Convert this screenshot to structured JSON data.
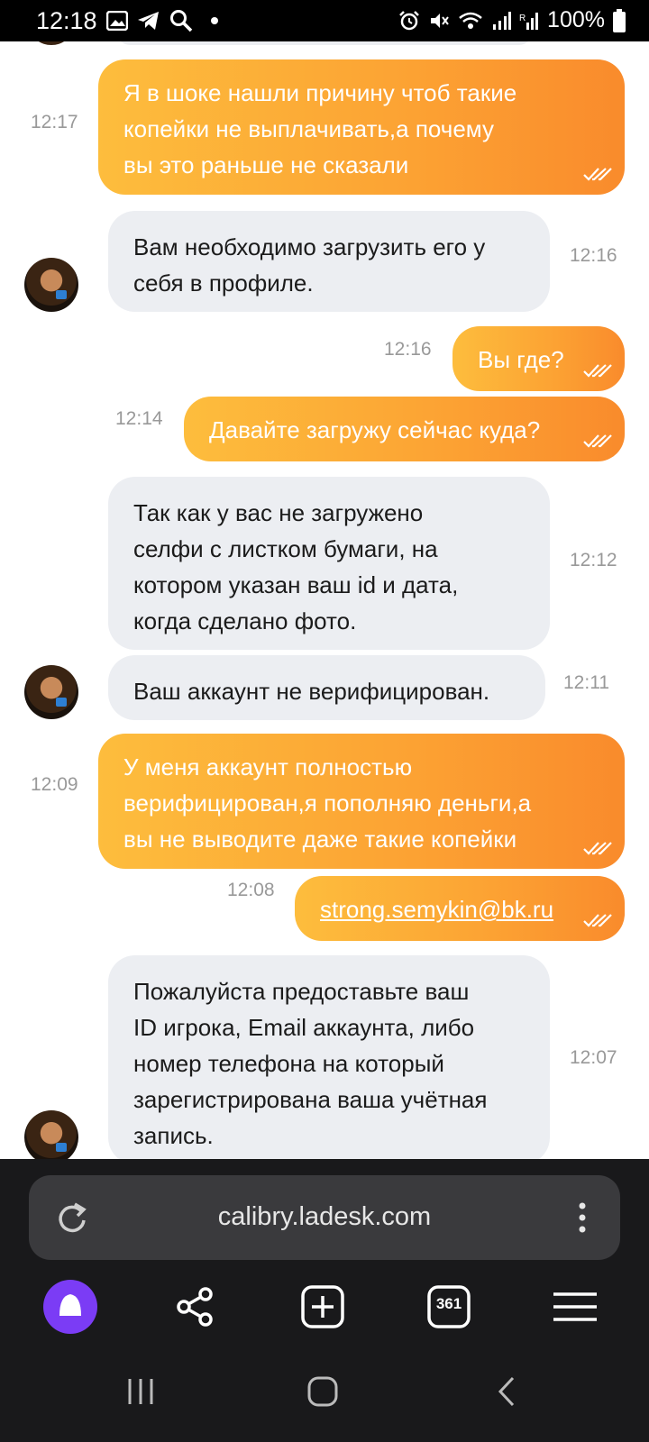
{
  "status_bar": {
    "time": "12:18",
    "battery": "100%"
  },
  "messages": [
    {
      "dir": "out",
      "time": "12:17",
      "lines": [
        "Я в шоке нашли причину чтоб такие",
        "копейки не выплачивать,а почему",
        "вы это раньше не сказали"
      ]
    },
    {
      "dir": "in",
      "time": "12:16",
      "lines": [
        "Вам необходимо загрузить его у",
        "себя в профиле."
      ]
    },
    {
      "dir": "out",
      "time": "12:16",
      "lines": [
        "Вы где?"
      ]
    },
    {
      "dir": "out",
      "time": "12:14",
      "lines": [
        "Давайте загружу сейчас куда?"
      ]
    },
    {
      "dir": "in",
      "time": "12:12",
      "lines": [
        "Так как у вас не загружено",
        "селфи с листком бумаги, на",
        "котором указан ваш id и дата,",
        "когда сделано фото."
      ]
    },
    {
      "dir": "in",
      "time": "12:11",
      "lines": [
        "Ваш аккаунт не верифицирован."
      ]
    },
    {
      "dir": "out",
      "time": "12:09",
      "lines": [
        "У меня аккаунт полностью",
        "верифицирован,я пополняю деньги,а",
        "вы не выводите даже такие копейки"
      ]
    },
    {
      "dir": "out",
      "time": "12:08",
      "lines": [
        "strong.semykin@bk.ru"
      ]
    },
    {
      "dir": "in",
      "time": "12:07",
      "lines": [
        "Пожалуйста предоставьте  ваш",
        "ID игрока, Email аккаунта, либо",
        "номер телефона на который",
        "зарегистрирована ваша учётная",
        "запись."
      ]
    }
  ],
  "browser": {
    "url": "calibry.ladesk.com",
    "tabs_count": "361"
  },
  "icons": {
    "status": [
      "gallery-icon",
      "telegram-icon",
      "search-icon",
      "dot-icon",
      "alarm-icon",
      "mute-icon",
      "wifi-icon",
      "signal-icon",
      "signal-r-icon",
      "battery-icon"
    ],
    "toolbar": [
      "alice-icon",
      "share-icon",
      "new-tab-icon",
      "tabs-icon",
      "menu-icon"
    ]
  },
  "colors": {
    "outgoing_start": "#fdbd3d",
    "outgoing_end": "#f98b2c",
    "incoming": "#eceef2",
    "alice": "#7b3cf5"
  }
}
